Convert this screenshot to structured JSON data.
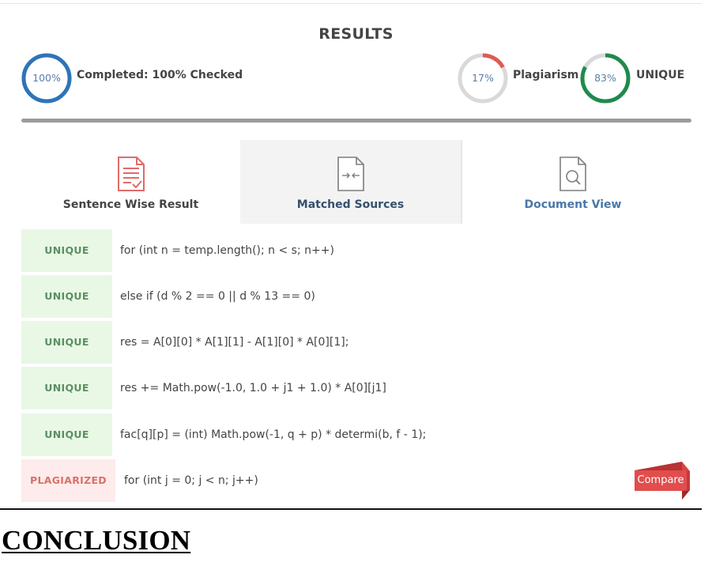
{
  "results_title": "RESULTS",
  "completed": {
    "percent_label": "100%",
    "percent": 100,
    "label": "Completed: 100% Checked",
    "color": "#2d74b8"
  },
  "plagiarism": {
    "percent_label": "17%",
    "percent": 17,
    "label": "Plagiarism",
    "color": "#e05a54"
  },
  "unique": {
    "percent_label": "83%",
    "percent": 83,
    "label": "UNIQUE",
    "color": "#1f8a4c"
  },
  "tabs": [
    {
      "label": "Sentence Wise Result",
      "icon": "document-check-icon",
      "color": "#444444",
      "active": false
    },
    {
      "label": "Matched Sources",
      "icon": "matched-sources-icon",
      "color": "#35506e",
      "active": true
    },
    {
      "label": "Document View",
      "icon": "document-search-icon",
      "color": "#4a77a6",
      "active": false
    }
  ],
  "rows": [
    {
      "status": "UNIQUE",
      "text": "for (int n = temp.length(); n < s; n++)"
    },
    {
      "status": "UNIQUE",
      "text": "else if (d % 2 == 0 || d % 13 == 0)"
    },
    {
      "status": "UNIQUE",
      "text": "res = A[0][0] * A[1][1] - A[1][0] * A[0][1];"
    },
    {
      "status": "UNIQUE",
      "text": "res += Math.pow(-1.0, 1.0 + j1 + 1.0) * A[0][j1]"
    },
    {
      "status": "UNIQUE",
      "text": "fac[q][p] = (int) Math.pow(-1, q + p) * determi(b, f - 1);"
    },
    {
      "status": "PLAGIARIZED",
      "text": "for (int j = 0; j < n; j++)"
    }
  ],
  "compare_label": "Compare",
  "conclusion": "CONCLUSION"
}
